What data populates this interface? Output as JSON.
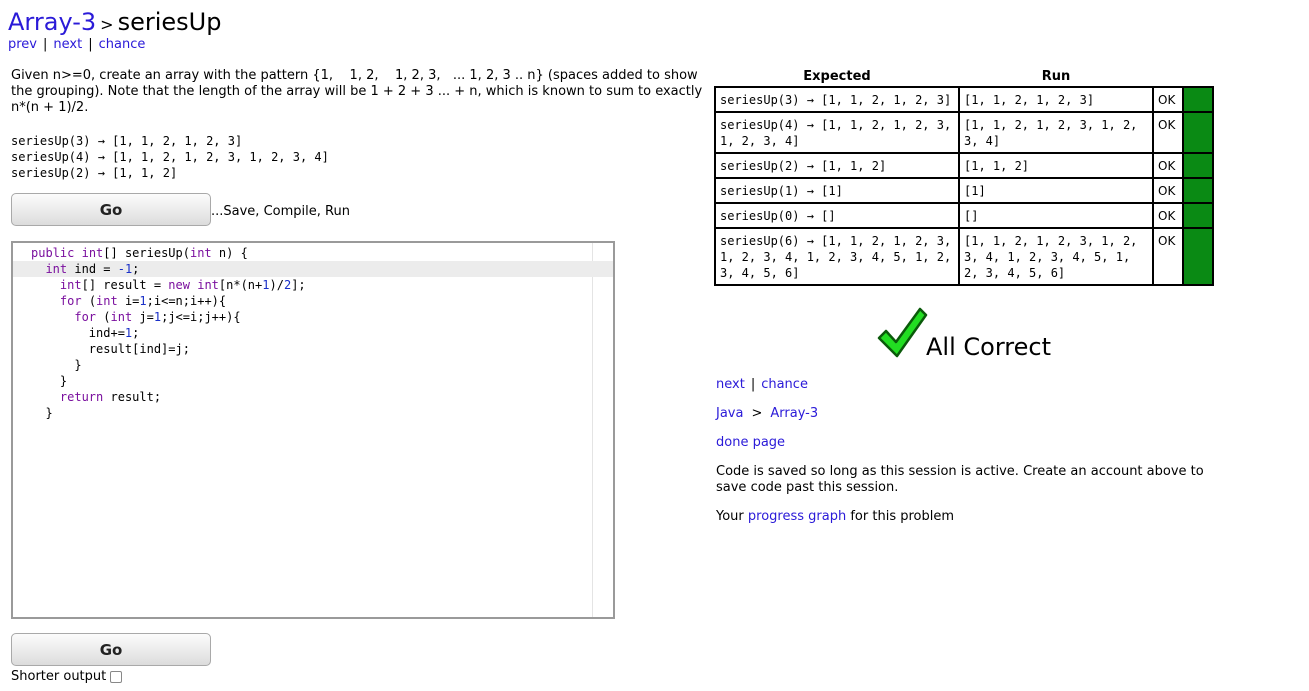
{
  "header": {
    "crumb": "Array-3",
    "separator": ">",
    "page_title": "seriesUp",
    "nav": [
      "prev",
      "next",
      "chance"
    ]
  },
  "problem": {
    "prompt": "Given n>=0, create an array with the pattern {1,    1, 2,    1, 2, 3,   ... 1, 2, 3 .. n} (spaces added to show the grouping). Note that the length of the array will be 1 + 2 + 3 ... + n, which is known to sum to exactly n*(n + 1)/2.",
    "examples": [
      "seriesUp(3) → [1, 1, 2, 1, 2, 3]",
      "seriesUp(4) → [1, 1, 2, 1, 2, 3, 1, 2, 3, 4]",
      "seriesUp(2) → [1, 1, 2]"
    ]
  },
  "controls": {
    "go_label": "Go",
    "go_note": "...Save, Compile, Run",
    "shorter_output_label": "Shorter output"
  },
  "editor": {
    "lines": [
      "public int[] seriesUp(int n) {",
      "  int ind = -1;",
      "    int[] result = new int[n*(n+1)/2];",
      "    for (int i=1;i<=n;i++){",
      "      for (int j=1;j<=i;j++){",
      "        ind+=1;",
      "        result[ind]=j;",
      "      }",
      "    }",
      "    return result;",
      "  }"
    ]
  },
  "results": {
    "headers": [
      "Expected",
      "Run"
    ],
    "rows": [
      {
        "expected": "seriesUp(3) → [1, 1, 2, 1, 2, 3]",
        "run": "[1, 1, 2, 1, 2, 3]",
        "status": "OK"
      },
      {
        "expected": "seriesUp(4) → [1, 1, 2, 1, 2, 3, 1, 2, 3, 4]",
        "run": "[1, 1, 2, 1, 2, 3, 1, 2, 3, 4]",
        "status": "OK"
      },
      {
        "expected": "seriesUp(2) → [1, 1, 2]",
        "run": "[1, 1, 2]",
        "status": "OK"
      },
      {
        "expected": "seriesUp(1) → [1]",
        "run": "[1]",
        "status": "OK"
      },
      {
        "expected": "seriesUp(0) → []",
        "run": "[]",
        "status": "OK"
      },
      {
        "expected": "seriesUp(6) → [1, 1, 2, 1, 2, 3, 1, 2, 3, 4, 1, 2, 3, 4, 5, 1, 2, 3, 4, 5, 6]",
        "run": "[1, 1, 2, 1, 2, 3, 1, 2, 3, 4, 1, 2, 3, 4, 5, 1, 2, 3, 4, 5, 6]",
        "status": "OK"
      }
    ],
    "pass_color": "#0a8a14"
  },
  "verdict": {
    "text": "All Correct",
    "check_color": "#22dd22"
  },
  "footer": {
    "nav": [
      "next",
      "chance"
    ],
    "crumbs": [
      "Java",
      ">",
      "Array-3"
    ],
    "done_page": "done page",
    "saved_note": "Code is saved so long as this session is active. Create an account above to save code past this session.",
    "progress_prefix": "Your",
    "progress_link": "progress graph",
    "progress_suffix": "for this problem"
  }
}
